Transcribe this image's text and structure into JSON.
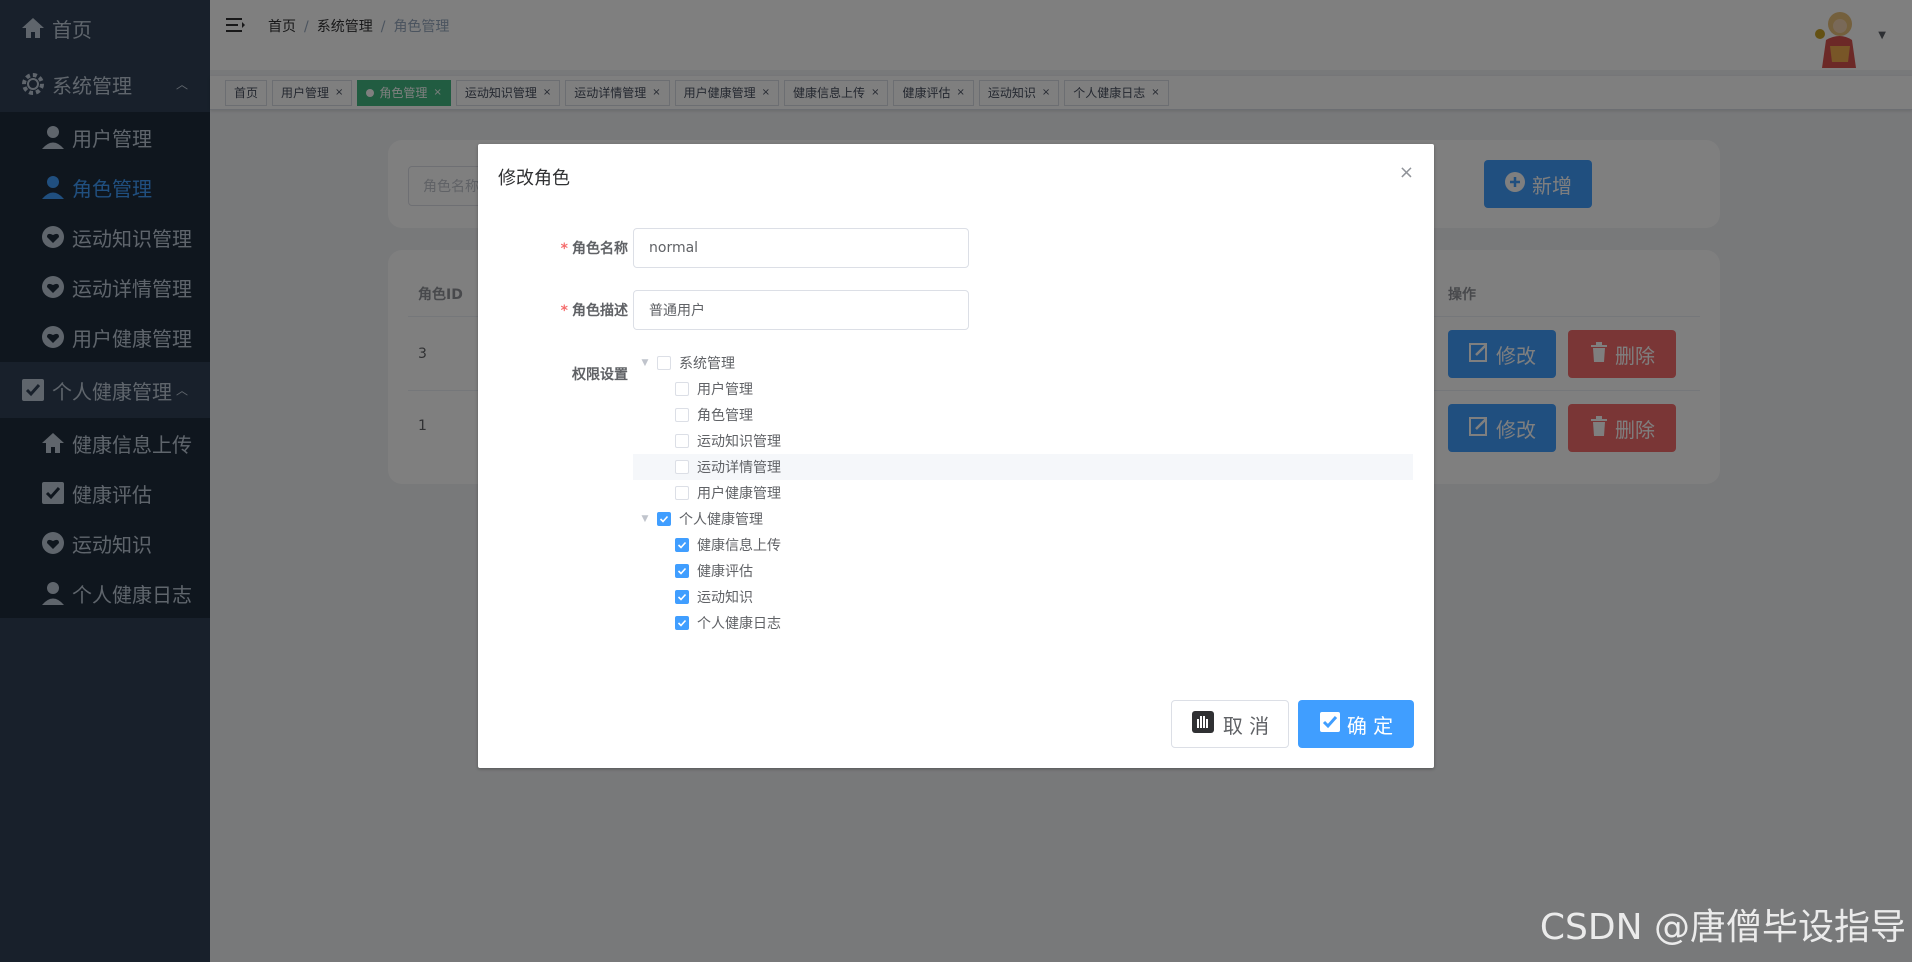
{
  "sidebar": {
    "home": "首页",
    "system": "系统管理",
    "system_items": [
      "用户管理",
      "角色管理",
      "运动知识管理",
      "运动详情管理",
      "用户健康管理"
    ],
    "personal": "个人健康管理",
    "personal_items": [
      "健康信息上传",
      "健康评估",
      "运动知识",
      "个人健康日志"
    ]
  },
  "header": {
    "breadcrumb": [
      "首页",
      "系统管理",
      "角色管理"
    ]
  },
  "tags": [
    {
      "label": "首页",
      "closable": false,
      "active": false
    },
    {
      "label": "用户管理",
      "closable": true,
      "active": false
    },
    {
      "label": "角色管理",
      "closable": true,
      "active": true
    },
    {
      "label": "运动知识管理",
      "closable": true,
      "active": false
    },
    {
      "label": "运动详情管理",
      "closable": true,
      "active": false
    },
    {
      "label": "用户健康管理",
      "closable": true,
      "active": false
    },
    {
      "label": "健康信息上传",
      "closable": true,
      "active": false
    },
    {
      "label": "健康评估",
      "closable": true,
      "active": false
    },
    {
      "label": "运动知识",
      "closable": true,
      "active": false
    },
    {
      "label": "个人健康日志",
      "closable": true,
      "active": false
    }
  ],
  "main": {
    "search_placeholder": "角色名称",
    "add_button": "新增",
    "table": {
      "col_id": "角色ID",
      "col_actions": "操作",
      "rows": [
        {
          "id": "3",
          "edit": "修改",
          "delete": "删除"
        },
        {
          "id": "1",
          "edit": "修改",
          "delete": "删除"
        }
      ]
    }
  },
  "dialog": {
    "title": "修改角色",
    "close": "×",
    "name_label": "角色名称",
    "name_value": "normal",
    "desc_label": "角色描述",
    "desc_value": "普通用户",
    "perm_label": "权限设置",
    "tree": [
      {
        "label": "系统管理",
        "level": 0,
        "checked": false,
        "expanded": true
      },
      {
        "label": "用户管理",
        "level": 1,
        "checked": false
      },
      {
        "label": "角色管理",
        "level": 1,
        "checked": false
      },
      {
        "label": "运动知识管理",
        "level": 1,
        "checked": false
      },
      {
        "label": "运动详情管理",
        "level": 1,
        "checked": false,
        "hover": true
      },
      {
        "label": "用户健康管理",
        "level": 1,
        "checked": false
      },
      {
        "label": "个人健康管理",
        "level": 0,
        "checked": true,
        "expanded": true
      },
      {
        "label": "健康信息上传",
        "level": 1,
        "checked": true
      },
      {
        "label": "健康评估",
        "level": 1,
        "checked": true
      },
      {
        "label": "运动知识",
        "level": 1,
        "checked": true
      },
      {
        "label": "个人健康日志",
        "level": 1,
        "checked": true
      }
    ],
    "cancel": "取 消",
    "confirm": "确 定"
  },
  "watermark": "CSDN @唐僧毕设指导",
  "colors": {
    "sidebar_bg": "#304156",
    "submenu_bg": "#1f2d3d",
    "primary": "#409eff",
    "danger": "#f56c6c",
    "tag_active": "#42b983"
  }
}
